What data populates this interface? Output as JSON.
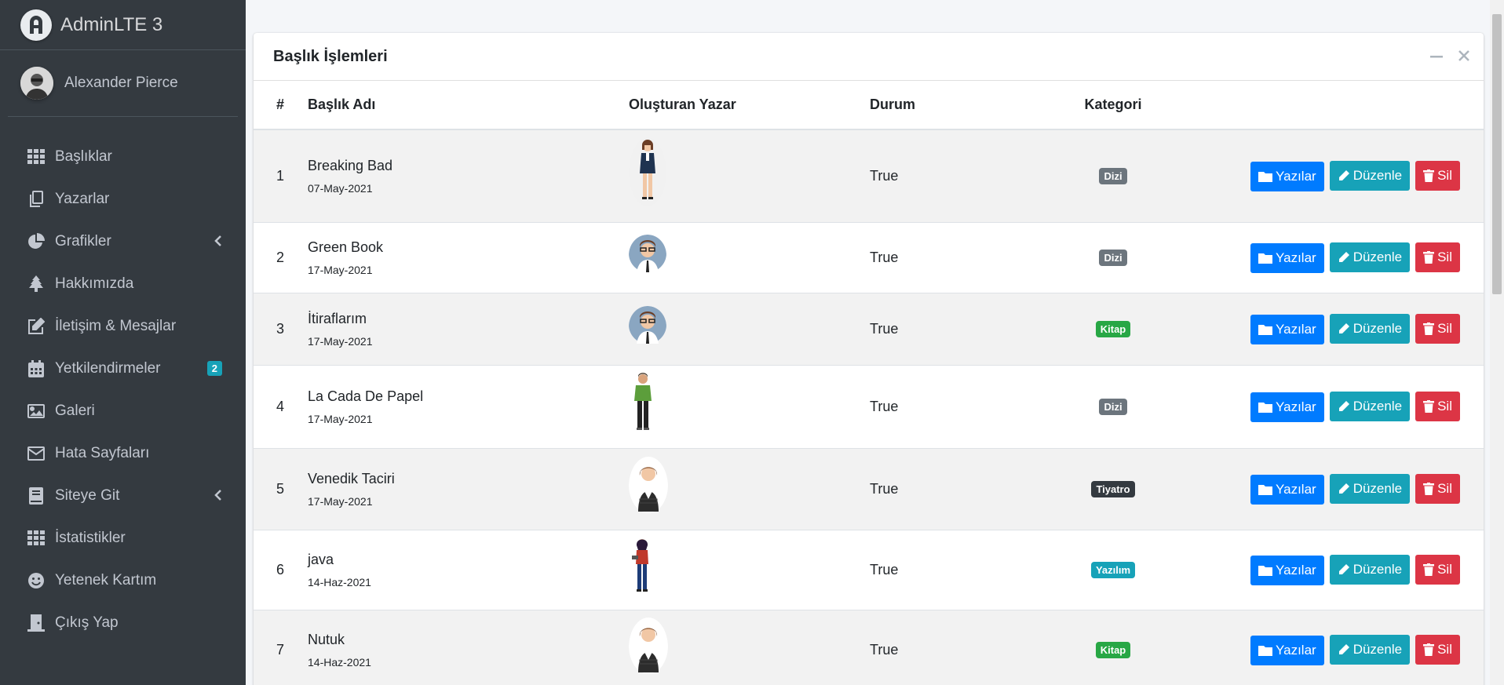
{
  "brand": {
    "title": "AdminLTE 3"
  },
  "user": {
    "name": "Alexander Pierce"
  },
  "sidebar": {
    "items": [
      {
        "label": "Başlıklar",
        "icon": "th-icon"
      },
      {
        "label": "Yazarlar",
        "icon": "copy-icon"
      },
      {
        "label": "Grafikler",
        "icon": "chart-pie-icon",
        "has_arrow": true
      },
      {
        "label": "Hakkımızda",
        "icon": "tree-icon"
      },
      {
        "label": "İletişim & Mesajlar",
        "icon": "edit-icon"
      },
      {
        "label": "Yetkilendirmeler",
        "icon": "calendar-icon",
        "badge": "2"
      },
      {
        "label": "Galeri",
        "icon": "image-icon"
      },
      {
        "label": "Hata Sayfaları",
        "icon": "envelope-icon"
      },
      {
        "label": "Siteye Git",
        "icon": "book-icon",
        "has_arrow": true
      },
      {
        "label": "İstatistikler",
        "icon": "th-icon"
      },
      {
        "label": "Yetenek Kartım",
        "icon": "smile-icon"
      },
      {
        "label": "Çıkış Yap",
        "icon": "door-icon"
      }
    ]
  },
  "card": {
    "title": "Başlık İşlemleri"
  },
  "table": {
    "headers": {
      "num": "#",
      "title": "Başlık Adı",
      "author": "Oluşturan Yazar",
      "status": "Durum",
      "category": "Kategori"
    },
    "rows": [
      {
        "num": "1",
        "title": "Breaking Bad",
        "date": "07-May-2021",
        "status": "True",
        "category": "Dizi",
        "avatar": "woman-suit"
      },
      {
        "num": "2",
        "title": "Green Book",
        "date": "17-May-2021",
        "status": "True",
        "category": "Dizi",
        "avatar": "man-glasses"
      },
      {
        "num": "3",
        "title": "İtiraflarım",
        "date": "17-May-2021",
        "status": "True",
        "category": "Kitap",
        "avatar": "man-glasses"
      },
      {
        "num": "4",
        "title": "La Cada De Papel",
        "date": "17-May-2021",
        "status": "True",
        "category": "Dizi",
        "avatar": "man-green"
      },
      {
        "num": "5",
        "title": "Venedik Taciri",
        "date": "17-May-2021",
        "status": "True",
        "category": "Tiyatro",
        "avatar": "woman-bust"
      },
      {
        "num": "6",
        "title": "java",
        "date": "14-Haz-2021",
        "status": "True",
        "category": "Yazılım",
        "avatar": "woman-red"
      },
      {
        "num": "7",
        "title": "Nutuk",
        "date": "14-Haz-2021",
        "status": "True",
        "category": "Kitap",
        "avatar": "woman-bust"
      }
    ],
    "actions": {
      "posts": "Yazılar",
      "edit": "Düzenle",
      "delete": "Sil"
    }
  },
  "colors": {
    "Dizi": "#6c757d",
    "Kitap": "#28a745",
    "Tiyatro": "#343a40",
    "Yazılım": "#17a2b8"
  }
}
